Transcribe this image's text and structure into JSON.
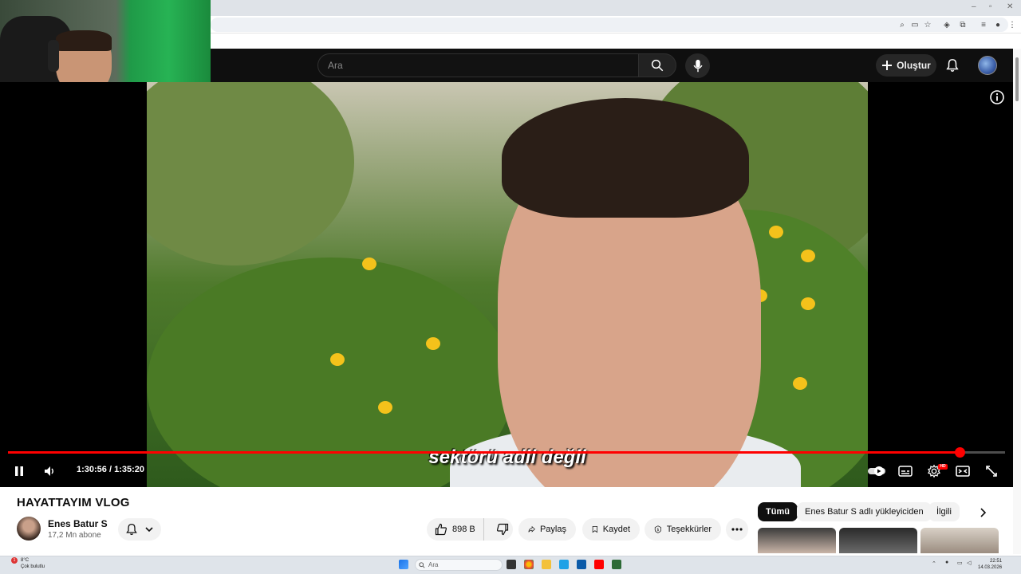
{
  "browser": {
    "window_controls": [
      "–",
      "▫",
      "✕"
    ]
  },
  "masthead": {
    "search_placeholder": "Ara",
    "create_label": "Oluştur"
  },
  "player": {
    "subtitle": "sektörü adil değil",
    "current_time": "1:30:56",
    "duration": "1:35:20",
    "time_display": "1:30:56 / 1:35:20",
    "progress_fraction": 0.954,
    "hd_badge": "HD"
  },
  "video": {
    "title": "HAYATTAYIM VLOG",
    "channel": {
      "name": "Enes Batur S",
      "subscribers": "17,2 Mn abone"
    },
    "actions": {
      "likes": "898 B",
      "share": "Paylaş",
      "save": "Kaydet",
      "thanks": "Teşekkürler"
    }
  },
  "related_chips": [
    "Tümü",
    "Enes Batur S adlı yükleyiciden",
    "İlgili"
  ],
  "taskbar": {
    "weather_temp": "8°C",
    "weather_desc": "Çok bulutlu",
    "search_placeholder": "Ara",
    "time": "22:51",
    "date": "14.03.2026",
    "notification_count": "1"
  },
  "colors": {
    "accent_red": "#ff0000",
    "masthead_bg": "#0f0f0f",
    "chip_active": "#0f0f0f"
  }
}
